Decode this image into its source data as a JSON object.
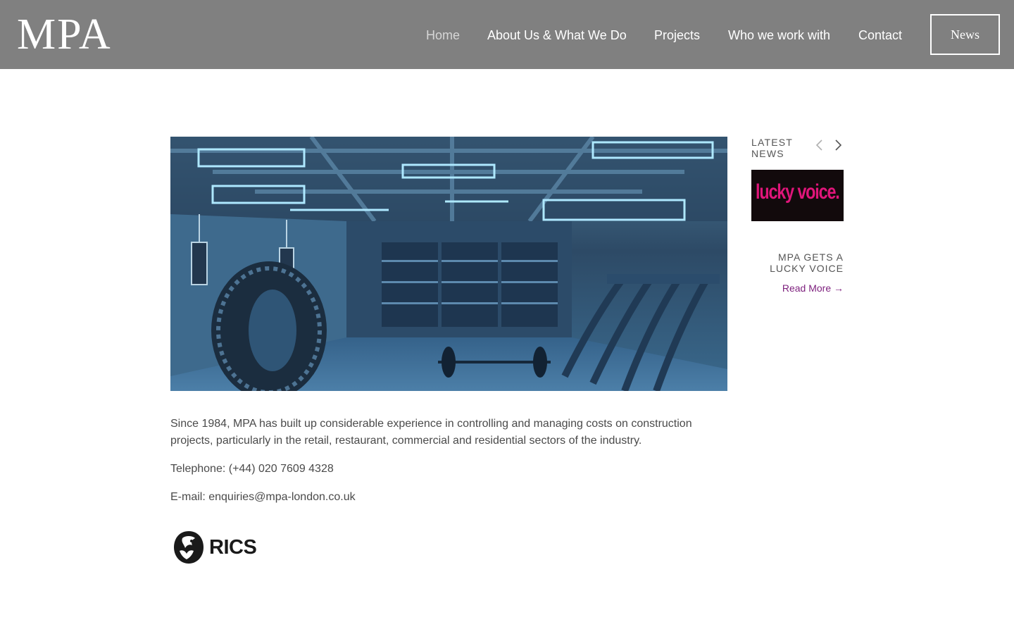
{
  "header": {
    "logo": "MPA",
    "nav": [
      {
        "label": "Home",
        "active": true
      },
      {
        "label": "About Us & What We Do",
        "active": false
      },
      {
        "label": "Projects",
        "active": false
      },
      {
        "label": "Who we work with",
        "active": false
      },
      {
        "label": "Contact",
        "active": false
      }
    ],
    "news_button": "News"
  },
  "main": {
    "intro": "Since 1984, MPA has built up considerable experience in controlling and managing costs on construction projects, particularly in the retail, restaurant, commercial and residential sectors of the industry.",
    "telephone": "Telephone: (+44) 020 7609 4328",
    "email": "E-mail: enquiries@mpa-london.co.uk",
    "accreditation_logo": "RICS"
  },
  "sidebar": {
    "latest_label": "LATEST NEWS",
    "post": {
      "thumbnail_text": "lucky voice.",
      "title": "MPA GETS A LUCKY VOICE",
      "read_more": "Read More →"
    }
  },
  "colors": {
    "header_bg": "#808080",
    "link_purple": "#7d1f7d",
    "thumb_pink": "#e0157a"
  }
}
